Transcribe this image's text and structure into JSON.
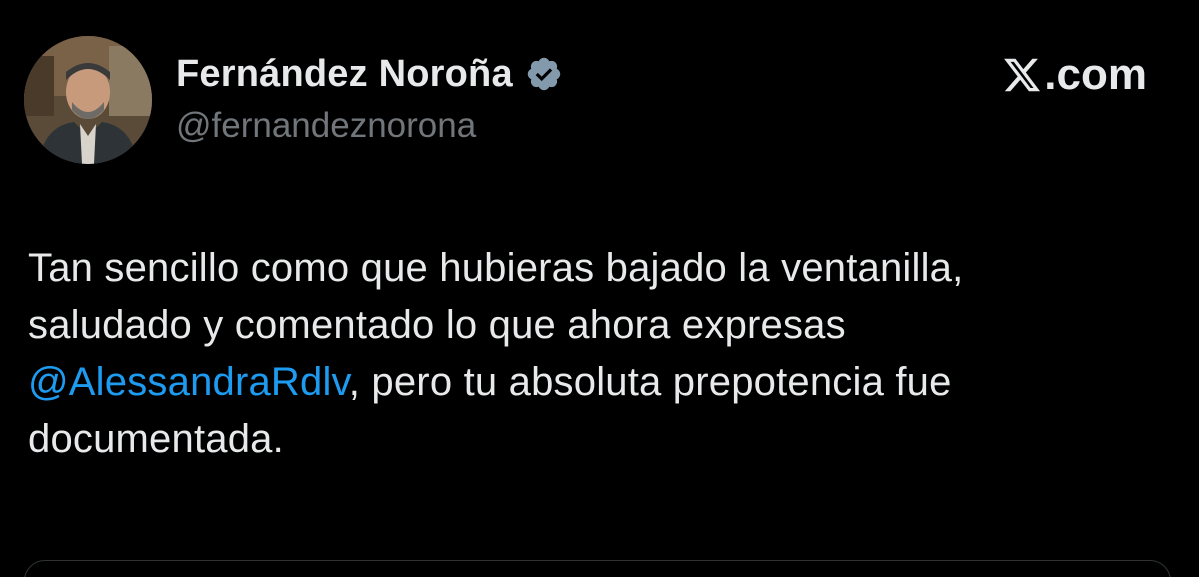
{
  "author": {
    "display_name": "Fernández Noroña",
    "handle": "@fernandeznorona",
    "verified": true,
    "avatar_alt": "profile photo"
  },
  "brand": {
    "suffix": ".com",
    "icon": "x-logo-icon"
  },
  "tweet": {
    "line1": "Tan sencillo como que hubieras bajado la ventanilla,",
    "line2": "saludado y comentado lo que ahora expresas",
    "mention": "@AlessandraRdlv",
    "line3_rest": ", pero tu absoluta prepotencia fue",
    "line4": "documentada."
  },
  "colors": {
    "background": "#000000",
    "text": "#e7e9ea",
    "secondary": "#71767b",
    "link": "#1d9bf0",
    "verified_badge": "#829aab"
  }
}
